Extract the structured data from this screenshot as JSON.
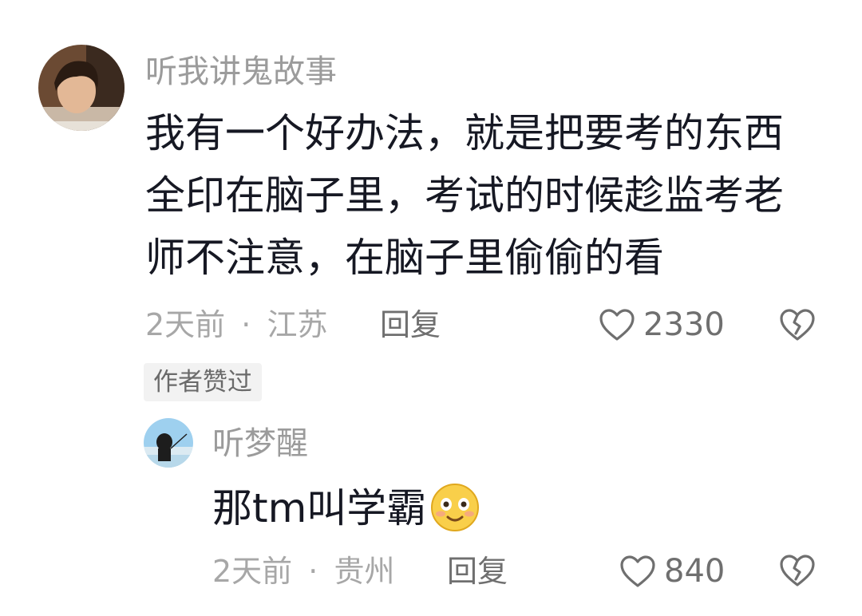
{
  "comment": {
    "username": "听我讲鬼故事",
    "text_lines": [
      "我有一个好办法，就是把要考的东西",
      "全印在脑子里，考试的时候趁监考老",
      "师不注意，在脑子里偷偷的看"
    ],
    "time": "2天前",
    "separator": "·",
    "location": "江苏",
    "reply_label": "回复",
    "like_count": "2330",
    "author_liked_badge": "作者赞过"
  },
  "reply": {
    "username": "听梦醒",
    "text": "那tm叫学霸",
    "emoji": "smiling-blush-emoji",
    "time": "2天前",
    "separator": "·",
    "location": "贵州",
    "reply_label": "回复",
    "like_count": "840"
  },
  "colors": {
    "username": "#9b9b9b",
    "body_text": "#161823",
    "meta": "#a7a7a7",
    "badge_bg": "#f2f2f2",
    "icon": "#6f6f6f"
  }
}
